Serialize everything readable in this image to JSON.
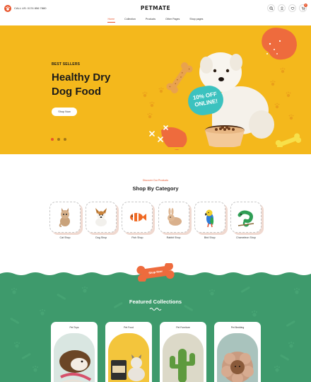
{
  "header": {
    "phone": "CALL US: 0174 856 7880",
    "brand": "PETMATE",
    "nav": [
      "Home",
      "Collection",
      "Products",
      "Other Pages",
      "Shop pages"
    ],
    "cart_count": "0",
    "icons": [
      "search-icon",
      "user-icon",
      "heart-icon",
      "cart-icon"
    ]
  },
  "hero": {
    "eyebrow": "BEST SELLERS",
    "title_line1": "Healthy Dry",
    "title_line2": "Dog Food",
    "button": "Shop Now",
    "offer_line1": "10% OFF",
    "offer_line2": "ONLINE!",
    "slides": 3,
    "active_slide": 1
  },
  "categories": {
    "eyebrow": "Discover Our Products",
    "title": "Shop By Category",
    "items": [
      {
        "label": "Cat Shop"
      },
      {
        "label": "Dog Shop"
      },
      {
        "label": "Fish Shop"
      },
      {
        "label": "Rabbit Shop"
      },
      {
        "label": "Bird Shop"
      },
      {
        "label": "Chameleon Shop"
      }
    ]
  },
  "featured": {
    "bone_label": "Shop Now",
    "title": "Featured Collections",
    "cards": [
      {
        "label": "Pet Toys"
      },
      {
        "label": "Pet Food"
      },
      {
        "label": "Pet Furniture"
      },
      {
        "label": "Pet Bedding"
      }
    ]
  },
  "colors": {
    "accent": "#e8542b",
    "hero_bg": "#f4b81c",
    "green_bg": "#3e9a6c",
    "teal": "#3cc2bf"
  }
}
